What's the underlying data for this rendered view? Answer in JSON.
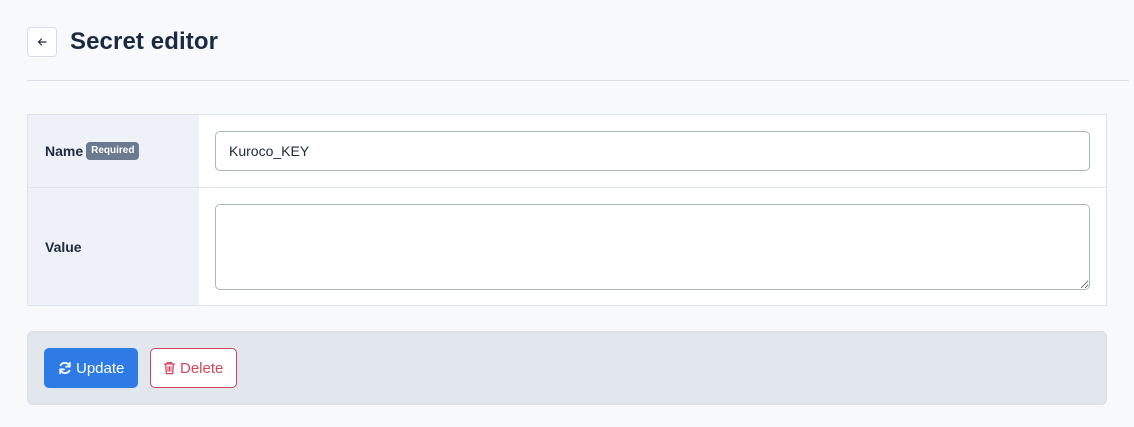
{
  "header": {
    "title": "Secret editor",
    "back_icon": "arrow-left-icon"
  },
  "form": {
    "name_label": "Name",
    "required_badge": "Required",
    "name_value": "Kuroco_KEY",
    "value_label": "Value",
    "value_value": ""
  },
  "actions": {
    "update_label": "Update",
    "update_icon": "refresh-icon",
    "delete_label": "Delete",
    "delete_icon": "trash-icon"
  },
  "colors": {
    "primary": "#2f7be5",
    "danger": "#d3455b",
    "badge": "#6b7a90",
    "background": "#f7f9fb"
  }
}
